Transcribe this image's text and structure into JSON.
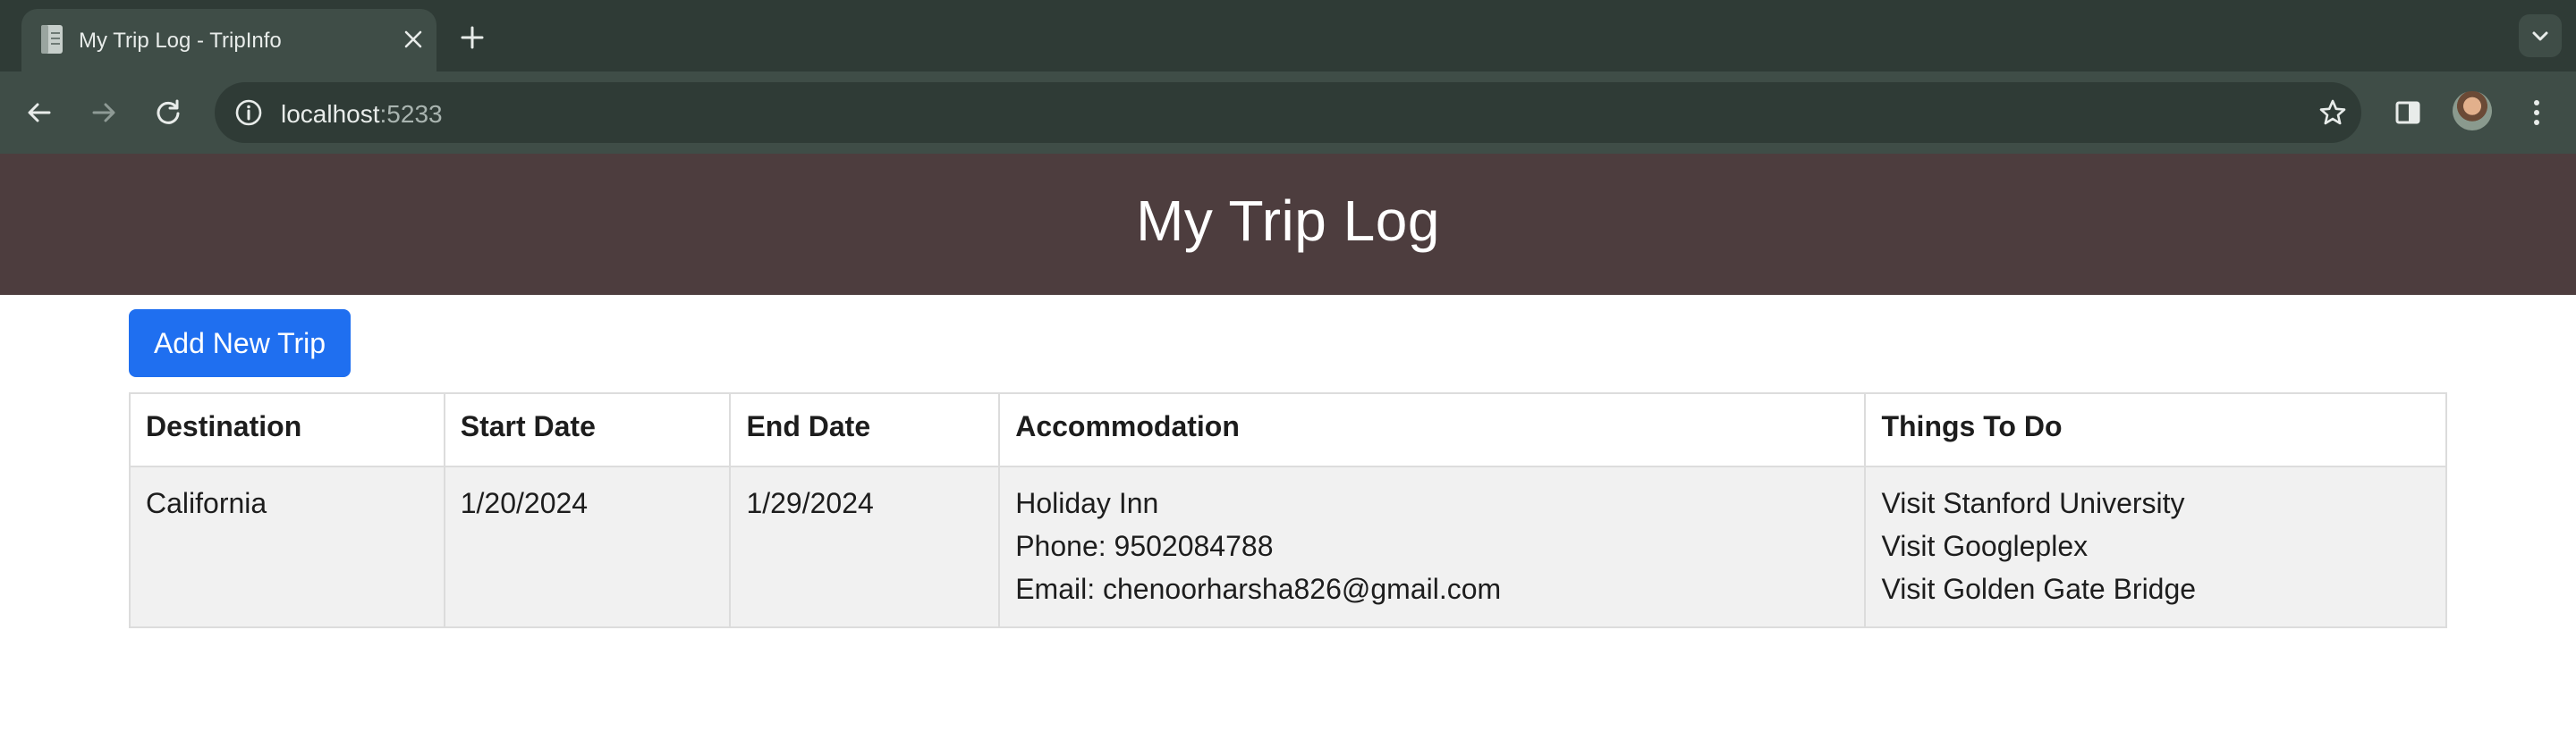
{
  "browser": {
    "tab_title": "My Trip Log - TripInfo",
    "url_host": "localhost",
    "url_port": ":5233"
  },
  "page": {
    "title": "My Trip Log",
    "add_button_label": "Add New Trip"
  },
  "table": {
    "headers": [
      "Destination",
      "Start Date",
      "End Date",
      "Accommodation",
      "Things To Do"
    ],
    "rows": [
      {
        "destination": "California",
        "start_date": "1/20/2024",
        "end_date": "1/29/2024",
        "accommodation": {
          "name": "Holiday Inn",
          "phone": "Phone: 9502084788",
          "email": "Email: chenoorharsha826@gmail.com"
        },
        "things_to_do": [
          "Visit Stanford University",
          "Visit Googleplex",
          "Visit Golden Gate Bridge"
        ]
      }
    ]
  },
  "colors": {
    "header_bg": "#4d3d3e",
    "button_bg": "#1f6ff0",
    "row_bg": "#f1f1f1"
  }
}
